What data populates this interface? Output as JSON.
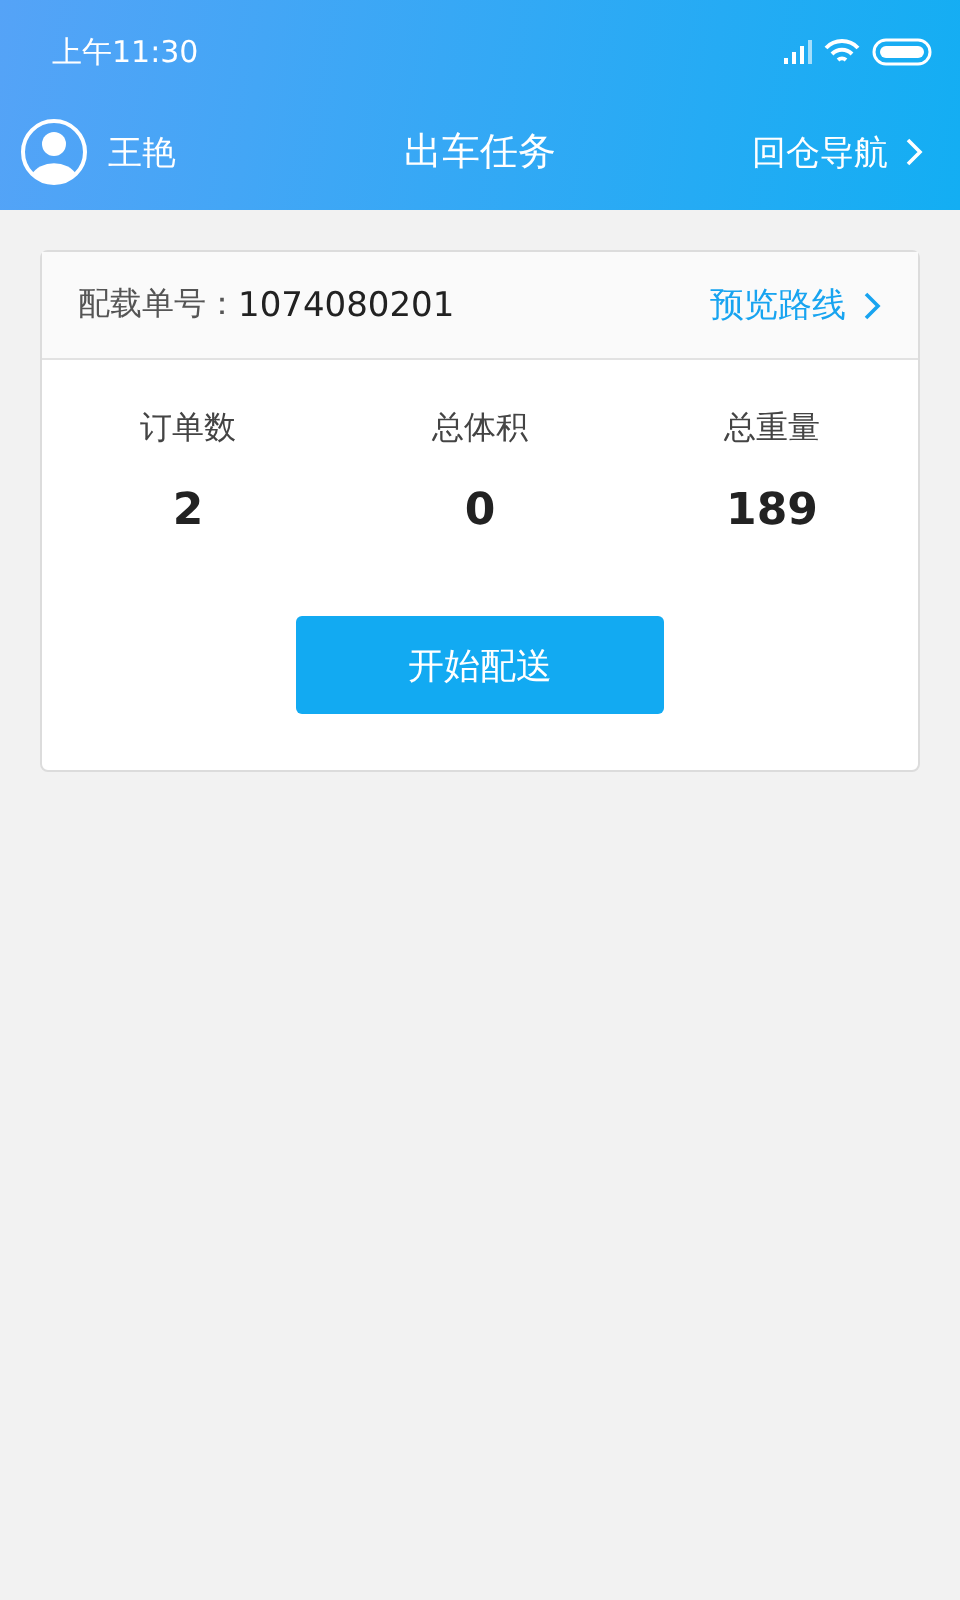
{
  "status_bar": {
    "time": "上午11:30"
  },
  "header": {
    "user": "王艳",
    "title": "出车任务",
    "action": "回仓导航"
  },
  "task": {
    "label": "配载单号：",
    "number": "1074080201",
    "link": "预览路线",
    "stats": [
      {
        "label": "订单数",
        "value": "2"
      },
      {
        "label": "总体积",
        "value": "0"
      },
      {
        "label": "总重量",
        "value": "189"
      }
    ],
    "button": "开始配送"
  }
}
